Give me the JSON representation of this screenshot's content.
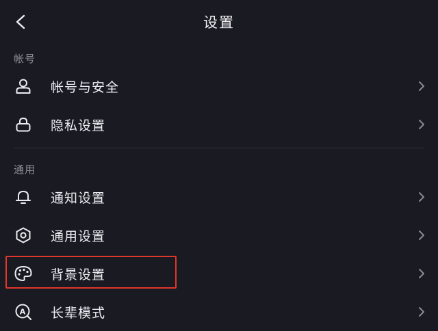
{
  "header": {
    "title": "设置",
    "back_icon": "back-arrow-icon"
  },
  "sections": [
    {
      "title": "帐号",
      "items": [
        {
          "label": "帐号与安全",
          "icon": "user-icon"
        },
        {
          "label": "隐私设置",
          "icon": "lock-icon"
        }
      ]
    },
    {
      "title": "通用",
      "items": [
        {
          "label": "通知设置",
          "icon": "bell-icon"
        },
        {
          "label": "通用设置",
          "icon": "gear-icon"
        },
        {
          "label": "背景设置",
          "icon": "palette-icon"
        },
        {
          "label": "长辈模式",
          "icon": "elder-mode-icon"
        }
      ]
    }
  ],
  "colors": {
    "background": "#1a1a22",
    "text": "#ececf1",
    "section_title": "#8d8d97",
    "chevron": "#8a8a93",
    "highlight": "#e1362c"
  }
}
